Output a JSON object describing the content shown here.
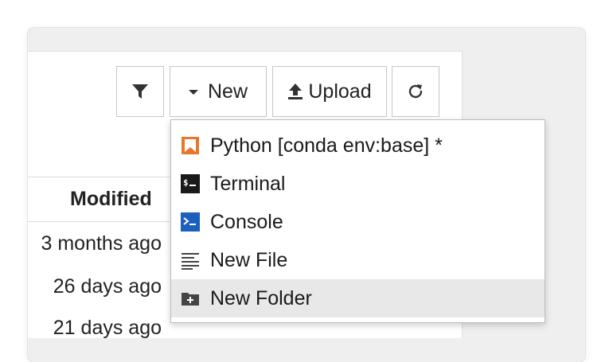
{
  "toolbar": {
    "new_label": "New",
    "upload_label": "Upload"
  },
  "file_list": {
    "modified_header": "Modified",
    "rows": [
      {
        "modified": "3 months ago"
      },
      {
        "modified": "26 days ago"
      },
      {
        "modified": "21 days ago"
      }
    ]
  },
  "new_menu": {
    "items": [
      {
        "label": "Python [conda env:base] *",
        "icon": "python-notebook-icon"
      },
      {
        "label": "Terminal",
        "icon": "terminal-icon"
      },
      {
        "label": "Console",
        "icon": "console-icon"
      },
      {
        "label": "New File",
        "icon": "text-file-icon"
      },
      {
        "label": "New Folder",
        "icon": "new-folder-icon"
      }
    ],
    "highlighted_item": "New Folder"
  },
  "colors": {
    "python_icon": "#e8762d",
    "terminal_icon": "#1a1a1a",
    "console_icon": "#1d5fbf",
    "highlight_bg": "#e8e8e8"
  }
}
